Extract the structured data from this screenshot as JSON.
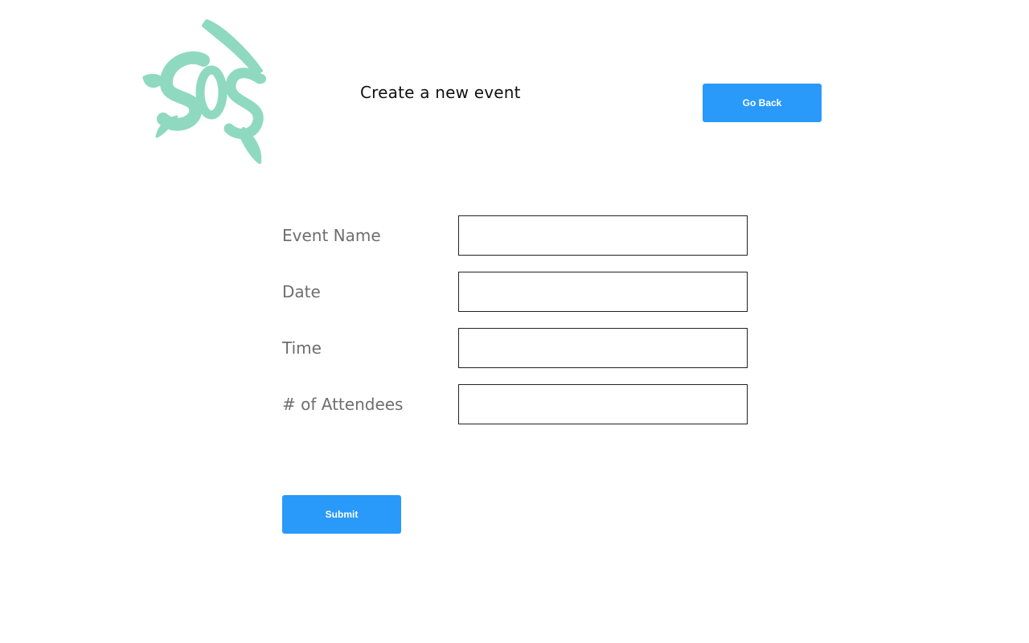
{
  "header": {
    "title": "Create a new event",
    "go_back_label": "Go Back",
    "logo_text": "SOS",
    "logo_color": "#8fd9c0"
  },
  "form": {
    "fields": [
      {
        "label": "Event Name",
        "value": "",
        "placeholder": ""
      },
      {
        "label": "Date",
        "value": "",
        "placeholder": ""
      },
      {
        "label": "Time",
        "value": "",
        "placeholder": ""
      },
      {
        "label": "# of Attendees",
        "value": "",
        "placeholder": ""
      }
    ],
    "submit_label": "Submit"
  },
  "colors": {
    "button": "#2999fa",
    "label": "#6e6e6e",
    "title": "#111111"
  }
}
